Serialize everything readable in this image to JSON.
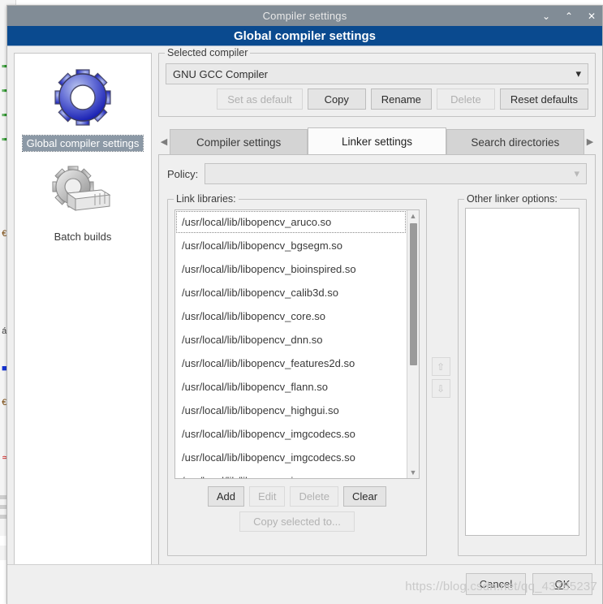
{
  "window": {
    "title": "Compiler settings",
    "controls": [
      {
        "name": "minimize",
        "glyph": "⌄"
      },
      {
        "name": "maximize",
        "glyph": "⌃"
      },
      {
        "name": "close",
        "glyph": "✕"
      }
    ],
    "banner": "Global compiler settings"
  },
  "sidebar": {
    "items": [
      {
        "label": "Global compiler settings",
        "icon": "blue-gear-icon",
        "selected": true
      },
      {
        "label": "Batch builds",
        "icon": "gray-gear-stack-icon",
        "selected": false
      }
    ]
  },
  "selected_compiler": {
    "group_title": "Selected compiler",
    "value": "GNU GCC Compiler",
    "dropdown_arrow": "▾",
    "buttons": [
      {
        "label": "Set as default",
        "enabled": false
      },
      {
        "label": "Copy",
        "enabled": true
      },
      {
        "label": "Rename",
        "enabled": true
      },
      {
        "label": "Delete",
        "enabled": false
      },
      {
        "label": "Reset defaults",
        "enabled": true
      }
    ]
  },
  "tabs": {
    "scroll_left": "◀",
    "scroll_right": "▶",
    "items": [
      {
        "label": "Compiler settings",
        "active": false
      },
      {
        "label": "Linker settings",
        "active": true
      },
      {
        "label": "Search directories",
        "active": false
      }
    ]
  },
  "linker_settings": {
    "policy_label": "Policy:",
    "policy_value": "",
    "policy_arrow": "▾",
    "link_libraries": {
      "group_title": "Link libraries:",
      "items": [
        "/usr/local/lib/libopencv_aruco.so",
        "/usr/local/lib/libopencv_bgsegm.so",
        "/usr/local/lib/libopencv_bioinspired.so",
        "/usr/local/lib/libopencv_calib3d.so",
        "/usr/local/lib/libopencv_core.so",
        "/usr/local/lib/libopencv_dnn.so",
        "/usr/local/lib/libopencv_features2d.so",
        "/usr/local/lib/libopencv_flann.so",
        "/usr/local/lib/libopencv_highgui.so",
        "/usr/local/lib/libopencv_imgcodecs.so",
        "/usr/local/lib/libopencv_imgcodecs.so",
        "/usr/local/lib/libopencv_imgproc.so"
      ],
      "focused_index": 0,
      "scroll_up_arrow": "▲",
      "scroll_down_arrow": "▼",
      "buttons": [
        {
          "label": "Add",
          "enabled": true
        },
        {
          "label": "Edit",
          "enabled": false
        },
        {
          "label": "Delete",
          "enabled": false
        },
        {
          "label": "Clear",
          "enabled": true
        }
      ],
      "copy_selected_label": "Copy selected to...",
      "copy_selected_enabled": false
    },
    "reorder": {
      "up_arrow": "⇧",
      "down_arrow": "⇩",
      "enabled": false
    },
    "other_linker_options": {
      "group_title": "Other linker options:",
      "value": ""
    }
  },
  "footer": {
    "cancel_label": "Cancel",
    "ok_label": "OK",
    "ok_accel": "O",
    "ok_rest": "K"
  },
  "watermark": "https://blog.csdn.net/qq_43785237",
  "colors": {
    "titlebar": "#818c96",
    "banner": "#0a4a8f",
    "dialog_bg": "#efefef",
    "selection": "#8c99a6",
    "list_bg": "#ffffff",
    "watermark": "#c9c9c9"
  }
}
